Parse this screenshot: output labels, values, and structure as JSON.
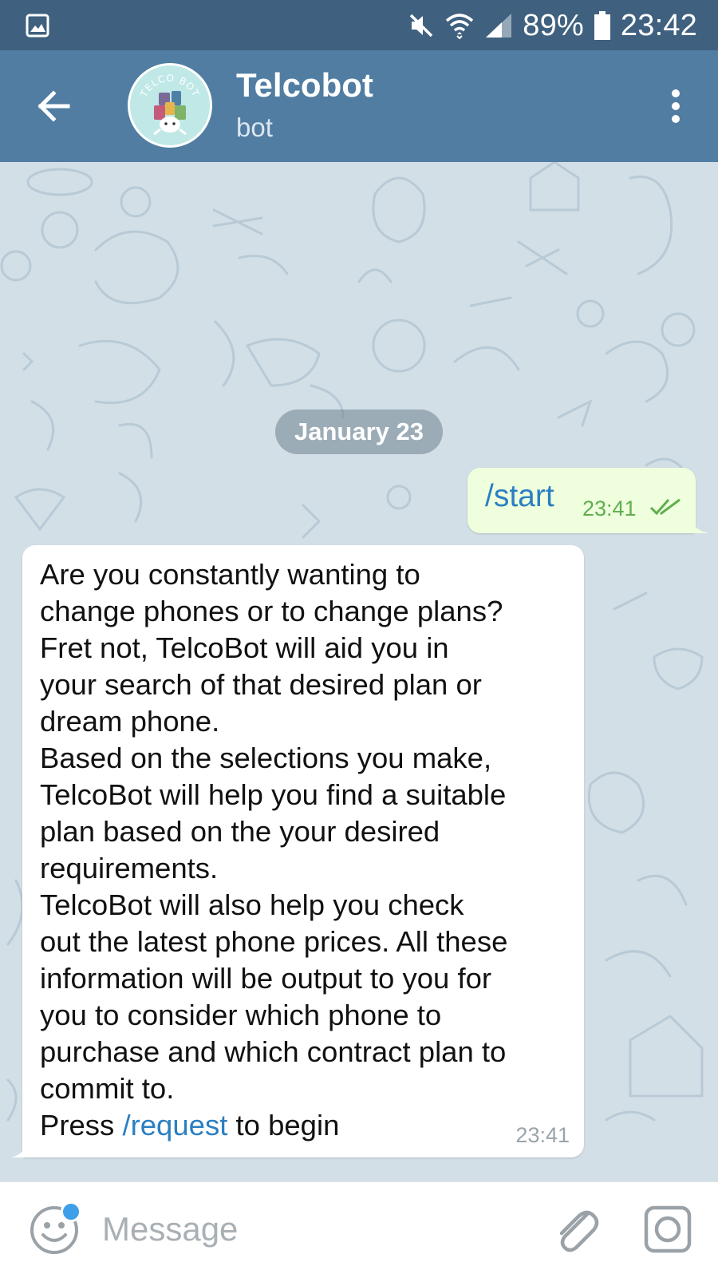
{
  "status_bar": {
    "battery": "89%",
    "time": "23:42",
    "icons": [
      "gallery-notification-icon",
      "mute-icon",
      "wifi-icon",
      "signal-icon",
      "battery-icon"
    ]
  },
  "header": {
    "title": "Telcobot",
    "subtitle": "bot",
    "avatar_text": "TELCO BOT",
    "icons": [
      "back-arrow-icon",
      "more-vert-icon"
    ]
  },
  "chat": {
    "date_label": "January 23",
    "outgoing": {
      "text": "/start",
      "time": "23:41",
      "status_icon": "double-check-icon"
    },
    "incoming": {
      "lines": [
        "Are you constantly wanting to",
        "change phones or to change plans?",
        "Fret not, TelcoBot will aid you in",
        "your search of that desired plan or",
        "dream phone.",
        "Based on the selections you make,",
        "TelcoBot will help you find a suitable",
        "plan based on the your desired",
        "requirements.",
        "TelcoBot will also help you check",
        "out the latest phone prices. All these",
        "information will be output to you for",
        "you to consider which phone to",
        "purchase and which contract plan to",
        "commit to."
      ],
      "last_line": {
        "before": "Press ",
        "command": "/request",
        "after": " to begin"
      },
      "time": "23:41"
    }
  },
  "input_bar": {
    "value": "",
    "placeholder": "Message",
    "icons": [
      "emoji-icon",
      "paperclip-icon",
      "camera-icon"
    ]
  },
  "colors": {
    "status_bar": "#3f617f",
    "header": "#517da2",
    "outgoing_bubble": "#efffde",
    "link": "#2b7fc2",
    "check": "#5fae4f"
  }
}
